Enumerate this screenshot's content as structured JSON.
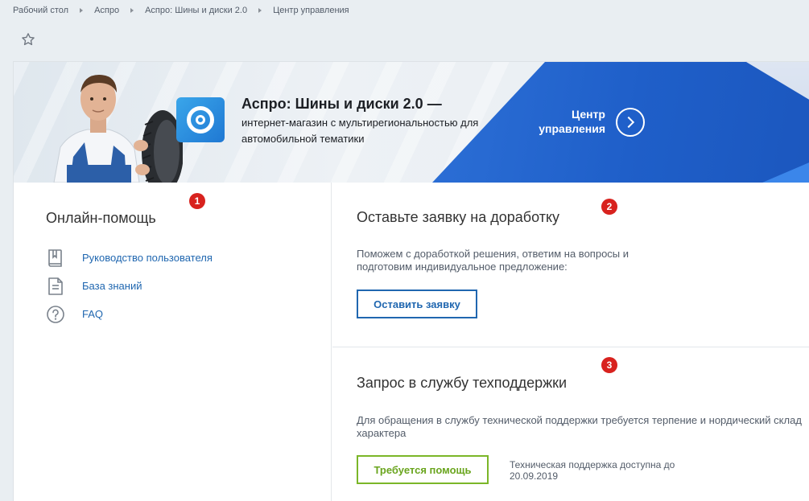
{
  "breadcrumb": [
    "Рабочий стол",
    "Аспро",
    "Аспро: Шины и диски 2.0",
    "Центр управления"
  ],
  "banner": {
    "title": "Аспро: Шины и диски 2.0 —",
    "subtitle": "интернет-магазин с мультирегиональностью для автомобильной тематики",
    "control_center": "Центр управления"
  },
  "online_help": {
    "badge": "1",
    "title": "Онлайн-помощь",
    "items": [
      {
        "label": "Руководство пользователя",
        "icon": "book-icon"
      },
      {
        "label": "База знаний",
        "icon": "document-icon"
      },
      {
        "label": "FAQ",
        "icon": "question-icon"
      }
    ]
  },
  "request": {
    "badge": "2",
    "title": "Оставьте заявку на доработку",
    "description": "Поможем с доработкой решения, ответим на вопросы и подготовим индивидуальное предложение:",
    "button": "Оставить заявку"
  },
  "support": {
    "badge": "3",
    "title": "Запрос в службу техподдержки",
    "description": "Для обращения в службу технической поддержки требуется терпение и нордический склад характера",
    "button": "Требуется помощь",
    "note": "Техническая поддержка доступна до 20.09.2019"
  },
  "colors": {
    "link": "#2067b0",
    "accent_blue": "#1f5fc9",
    "accent_green": "#7bb628",
    "badge_red": "#d8221e"
  }
}
